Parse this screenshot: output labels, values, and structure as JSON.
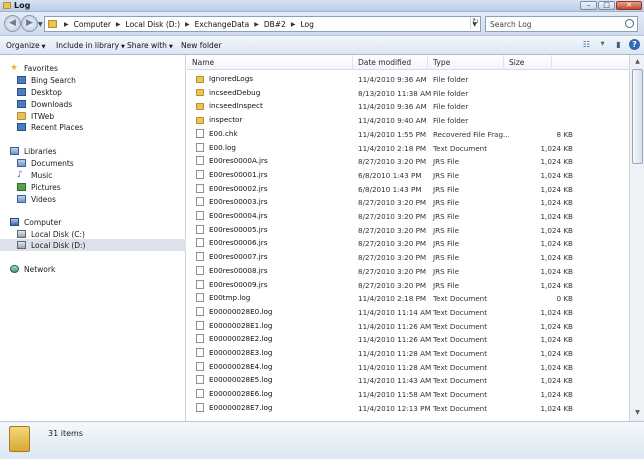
{
  "window": {
    "title": "Log"
  },
  "address": {
    "crumbs": [
      "Computer",
      "Local Disk (D:)",
      "ExchangeData",
      "DB#2",
      "Log"
    ],
    "search_placeholder": "Search Log"
  },
  "commands": {
    "organize": "Organize",
    "include": "Include in library",
    "share": "Share with",
    "newfolder": "New folder"
  },
  "nav": {
    "favorites": "Favorites",
    "bing": "Bing Search",
    "desktop": "Desktop",
    "downloads": "Downloads",
    "itweb": "ITWeb",
    "recent": "Recent Places",
    "libraries": "Libraries",
    "documents": "Documents",
    "music": "Music",
    "pictures": "Pictures",
    "videos": "Videos",
    "computer": "Computer",
    "diskc": "Local Disk (C:)",
    "diskd": "Local Disk (D:)",
    "network": "Network"
  },
  "columns": {
    "name": "Name",
    "date": "Date modified",
    "type": "Type",
    "size": "Size"
  },
  "files": [
    {
      "name": "IgnoredLogs",
      "date": "11/4/2010 9:36 AM",
      "type": "File folder",
      "size": ""
    },
    {
      "name": "incseedDebug",
      "date": "8/13/2010 11:38 AM",
      "type": "File folder",
      "size": ""
    },
    {
      "name": "incseedInspect",
      "date": "11/4/2010 9:36 AM",
      "type": "File folder",
      "size": ""
    },
    {
      "name": "inspector",
      "date": "11/4/2010 9:40 AM",
      "type": "File folder",
      "size": ""
    },
    {
      "name": "E00.chk",
      "date": "11/4/2010 1:55 PM",
      "type": "Recovered File Frag...",
      "size": "8 KB"
    },
    {
      "name": "E00.log",
      "date": "11/4/2010 2:18 PM",
      "type": "Text Document",
      "size": "1,024 KB"
    },
    {
      "name": "E00res0000A.jrs",
      "date": "8/27/2010 3:20 PM",
      "type": "JRS File",
      "size": "1,024 KB"
    },
    {
      "name": "E00res00001.jrs",
      "date": "6/8/2010 1:43 PM",
      "type": "JRS File",
      "size": "1,024 KB"
    },
    {
      "name": "E00res00002.jrs",
      "date": "6/8/2010 1:43 PM",
      "type": "JRS File",
      "size": "1,024 KB"
    },
    {
      "name": "E00res00003.jrs",
      "date": "8/27/2010 3:20 PM",
      "type": "JRS File",
      "size": "1,024 KB"
    },
    {
      "name": "E00res00004.jrs",
      "date": "8/27/2010 3:20 PM",
      "type": "JRS File",
      "size": "1,024 KB"
    },
    {
      "name": "E00res00005.jrs",
      "date": "8/27/2010 3:20 PM",
      "type": "JRS File",
      "size": "1,024 KB"
    },
    {
      "name": "E00res00006.jrs",
      "date": "8/27/2010 3:20 PM",
      "type": "JRS File",
      "size": "1,024 KB"
    },
    {
      "name": "E00res00007.jrs",
      "date": "8/27/2010 3:20 PM",
      "type": "JRS File",
      "size": "1,024 KB"
    },
    {
      "name": "E00res00008.jrs",
      "date": "8/27/2010 3:20 PM",
      "type": "JRS File",
      "size": "1,024 KB"
    },
    {
      "name": "E00res00009.jrs",
      "date": "8/27/2010 3:20 PM",
      "type": "JRS File",
      "size": "1,024 KB"
    },
    {
      "name": "E00tmp.log",
      "date": "11/4/2010 2:18 PM",
      "type": "Text Document",
      "size": "0 KB"
    },
    {
      "name": "E00000028E0.log",
      "date": "11/4/2010 11:14 AM",
      "type": "Text Document",
      "size": "1,024 KB"
    },
    {
      "name": "E00000028E1.log",
      "date": "11/4/2010 11:26 AM",
      "type": "Text Document",
      "size": "1,024 KB"
    },
    {
      "name": "E00000028E2.log",
      "date": "11/4/2010 11:26 AM",
      "type": "Text Document",
      "size": "1,024 KB"
    },
    {
      "name": "E00000028E3.log",
      "date": "11/4/2010 11:28 AM",
      "type": "Text Document",
      "size": "1,024 KB"
    },
    {
      "name": "E00000028E4.log",
      "date": "11/4/2010 11:28 AM",
      "type": "Text Document",
      "size": "1,024 KB"
    },
    {
      "name": "E00000028E5.log",
      "date": "11/4/2010 11:43 AM",
      "type": "Text Document",
      "size": "1,024 KB"
    },
    {
      "name": "E00000028E6.log",
      "date": "11/4/2010 11:58 AM",
      "type": "Text Document",
      "size": "1,024 KB"
    },
    {
      "name": "E00000028E7.log",
      "date": "11/4/2010 12:13 PM",
      "type": "Text Document",
      "size": "1,024 KB"
    }
  ],
  "status": {
    "item_count": "31 items"
  },
  "icons": {
    "back": "back-arrow-icon",
    "forward": "forward-arrow-icon",
    "search": "search-icon",
    "folder": "folder-icon",
    "document": "document-icon"
  }
}
